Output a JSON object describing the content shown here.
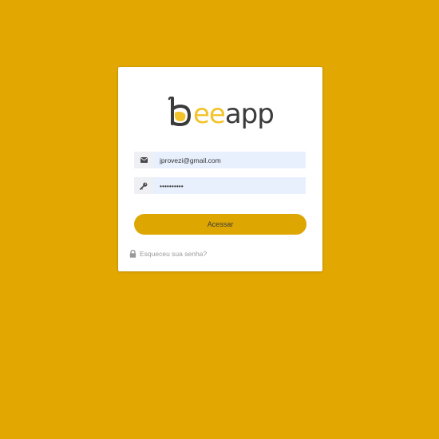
{
  "logo": {
    "brand_prefix": "b",
    "brand_accent": "ee",
    "brand_suffix": "app",
    "accent_color": "#F2C32A",
    "dark_color": "#3b3b3b"
  },
  "form": {
    "email_icon": "envelope-icon",
    "email_value": "jprovezi@gmail.com",
    "password_icon": "key-icon",
    "password_value": "••••••••••",
    "submit_label": "Acessar",
    "forgot_icon": "lock-icon",
    "forgot_label": "Esqueceu sua senha?"
  },
  "colors": {
    "background": "#E2A700",
    "button": "#DDA600",
    "input_fill": "#E8F0FE"
  }
}
